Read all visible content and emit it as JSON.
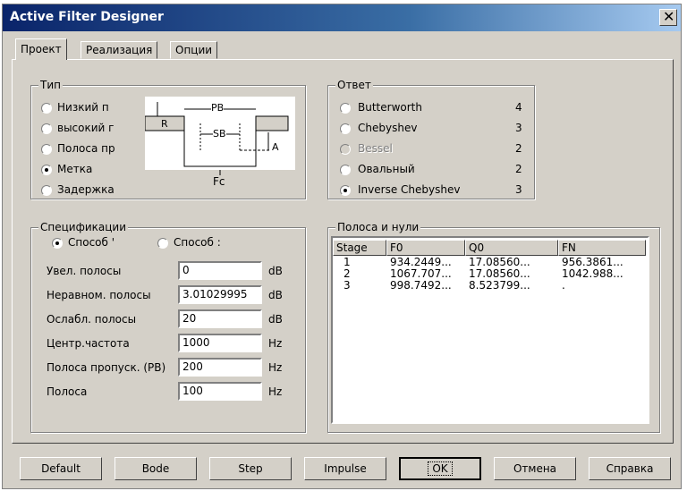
{
  "window": {
    "title": "Active Filter Designer"
  },
  "tabs": [
    "Проект",
    "Реализация",
    "Опции"
  ],
  "type_group": {
    "label": "Тип",
    "options": [
      {
        "label": "Низкий п",
        "selected": false
      },
      {
        "label": "высокий г",
        "selected": false
      },
      {
        "label": "Полоса пр",
        "selected": false
      },
      {
        "label": "Метка",
        "selected": true
      },
      {
        "label": "Задержка",
        "selected": false
      }
    ],
    "diagram": {
      "pb": "PB",
      "sb": "SB",
      "r": "R",
      "a": "A",
      "fc": "Fc"
    }
  },
  "response_group": {
    "label": "Ответ",
    "options": [
      {
        "label": "Butterworth",
        "order": "4",
        "selected": false,
        "disabled": false
      },
      {
        "label": "Chebyshev",
        "order": "3",
        "selected": false,
        "disabled": false
      },
      {
        "label": "Bessel",
        "order": "2",
        "selected": false,
        "disabled": true
      },
      {
        "label": "Овальный",
        "order": "2",
        "selected": false,
        "disabled": false
      },
      {
        "label": "Inverse Chebyshev",
        "order": "3",
        "selected": true,
        "disabled": false
      }
    ]
  },
  "spec_group": {
    "label": "Спецификации",
    "mode_options": [
      {
        "label": "Способ '",
        "selected": true
      },
      {
        "label": "Способ :",
        "selected": false
      }
    ],
    "fields": [
      {
        "label": "Увел. полосы",
        "value": "0",
        "unit": "dB"
      },
      {
        "label": "Неравном. полосы",
        "value": "3.01029995",
        "unit": "dB"
      },
      {
        "label": "Ослабл. полосы",
        "value": "20",
        "unit": "dB"
      },
      {
        "label": "Центр.частота",
        "value": "1000",
        "unit": "Hz"
      },
      {
        "label": "Полоса пропуск. (PB)",
        "value": "200",
        "unit": "Hz"
      },
      {
        "label": "Полоса",
        "value": "100",
        "unit": "Hz"
      }
    ]
  },
  "poles_group": {
    "label": "Полоса и нули",
    "columns": [
      "Stage",
      "F0",
      "Q0",
      "FN"
    ],
    "rows": [
      [
        "1",
        "934.2449...",
        "17.08560...",
        "956.3861..."
      ],
      [
        "2",
        "1067.707...",
        "17.08560...",
        "1042.988..."
      ],
      [
        "3",
        "998.7492...",
        "8.523799...",
        "."
      ]
    ]
  },
  "buttons": [
    "Default",
    "Bode",
    "Step",
    "Impulse",
    "OK",
    "Отмена",
    "Справка"
  ]
}
